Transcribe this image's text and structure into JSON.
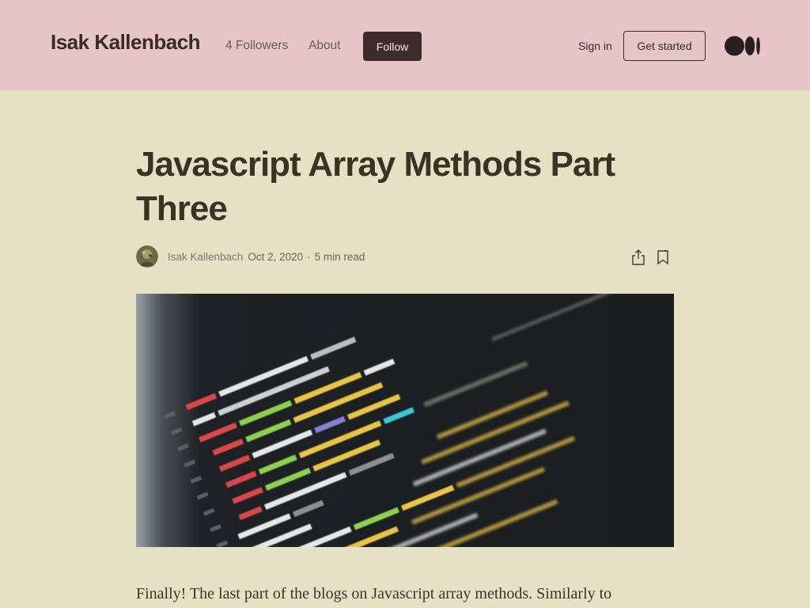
{
  "header": {
    "brand": "Isak Kallenbach",
    "followers": "4 Followers",
    "about": "About",
    "follow_label": "Follow",
    "sign_in": "Sign in",
    "get_started": "Get started",
    "logo_icon": "medium-logo-icon"
  },
  "article": {
    "title": "Javascript Array Methods Part Three",
    "author": "Isak Kallenbach",
    "date": "Oct 2, 2020",
    "read_time": "5 min read",
    "hero_image": "code-editor-screenshot",
    "intro": "Finally! The last part of the blogs on Javascript array methods. Similarly to"
  },
  "colors": {
    "header_bg": "#e5c5c7",
    "page_bg": "#e6e1c4",
    "follow_bg": "#3e2b2d",
    "title_color": "#383325"
  }
}
